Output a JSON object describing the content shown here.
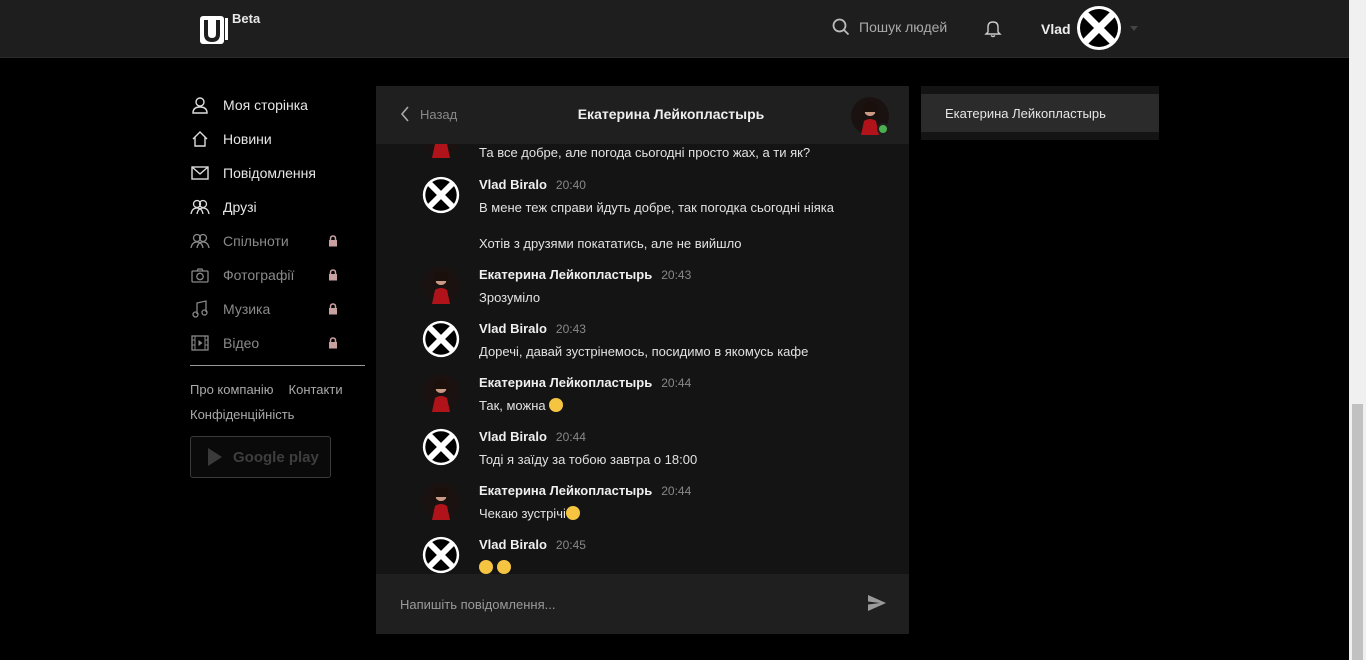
{
  "header": {
    "beta": "Beta",
    "search_label": "Пошук людей",
    "username": "Vlad"
  },
  "sidebar": {
    "items": [
      {
        "label": "Моя сторінка",
        "icon": "user-icon",
        "locked": false
      },
      {
        "label": "Новини",
        "icon": "home-icon",
        "locked": false
      },
      {
        "label": "Повідомлення",
        "icon": "mail-icon",
        "locked": false
      },
      {
        "label": "Друзі",
        "icon": "friends-icon",
        "locked": false
      },
      {
        "label": "Спільноти",
        "icon": "communities-icon",
        "locked": true
      },
      {
        "label": "Фотографії",
        "icon": "camera-icon",
        "locked": true
      },
      {
        "label": "Музика",
        "icon": "music-icon",
        "locked": true
      },
      {
        "label": "Відео",
        "icon": "video-icon",
        "locked": true
      }
    ],
    "footer": {
      "about": "Про компанію",
      "contacts": "Контакти",
      "privacy": "Конфіденційність"
    },
    "google_play": "Google play"
  },
  "chat": {
    "back": "Назад",
    "title": "Екатерина Лейкопластырь",
    "partial_message": "Та все добре, але погода сьогодні просто жах, а ти як?",
    "messages": [
      {
        "author": "Vlad Biralo",
        "time": "20:40",
        "lines": [
          "В мене теж справи йдуть добре, так погодка сьогодні ніяка",
          "Хотів з друзями покататись, але не вийшло"
        ]
      },
      {
        "author": "Екатерина Лейкопластырь",
        "time": "20:43",
        "lines": [
          "Зрозуміло"
        ]
      },
      {
        "author": "Vlad Biralo",
        "time": "20:43",
        "lines": [
          "Доречі, давай зустрінемось, посидимо в якомусь кафе"
        ]
      },
      {
        "author": "Екатерина Лейкопластырь",
        "time": "20:44",
        "lines": [
          "Так, можна"
        ]
      },
      {
        "author": "Vlad Biralo",
        "time": "20:44",
        "lines": [
          "Тоді я заїду за тобою завтра о 18:00"
        ]
      },
      {
        "author": "Екатерина Лейкопластырь",
        "time": "20:44",
        "lines": [
          "Чекаю зустрічі"
        ]
      },
      {
        "author": "Vlad Biralo",
        "time": "20:45",
        "lines": [
          ""
        ]
      }
    ],
    "composer_placeholder": "Напишіть повідомлення..."
  },
  "conversations": [
    {
      "name": "Екатерина Лейкопластырь"
    }
  ],
  "colors": {
    "background": "#000000",
    "panel": "#141414",
    "header": "#1f1f1f",
    "online": "#4caf50",
    "lock": "#c9a0a0"
  }
}
